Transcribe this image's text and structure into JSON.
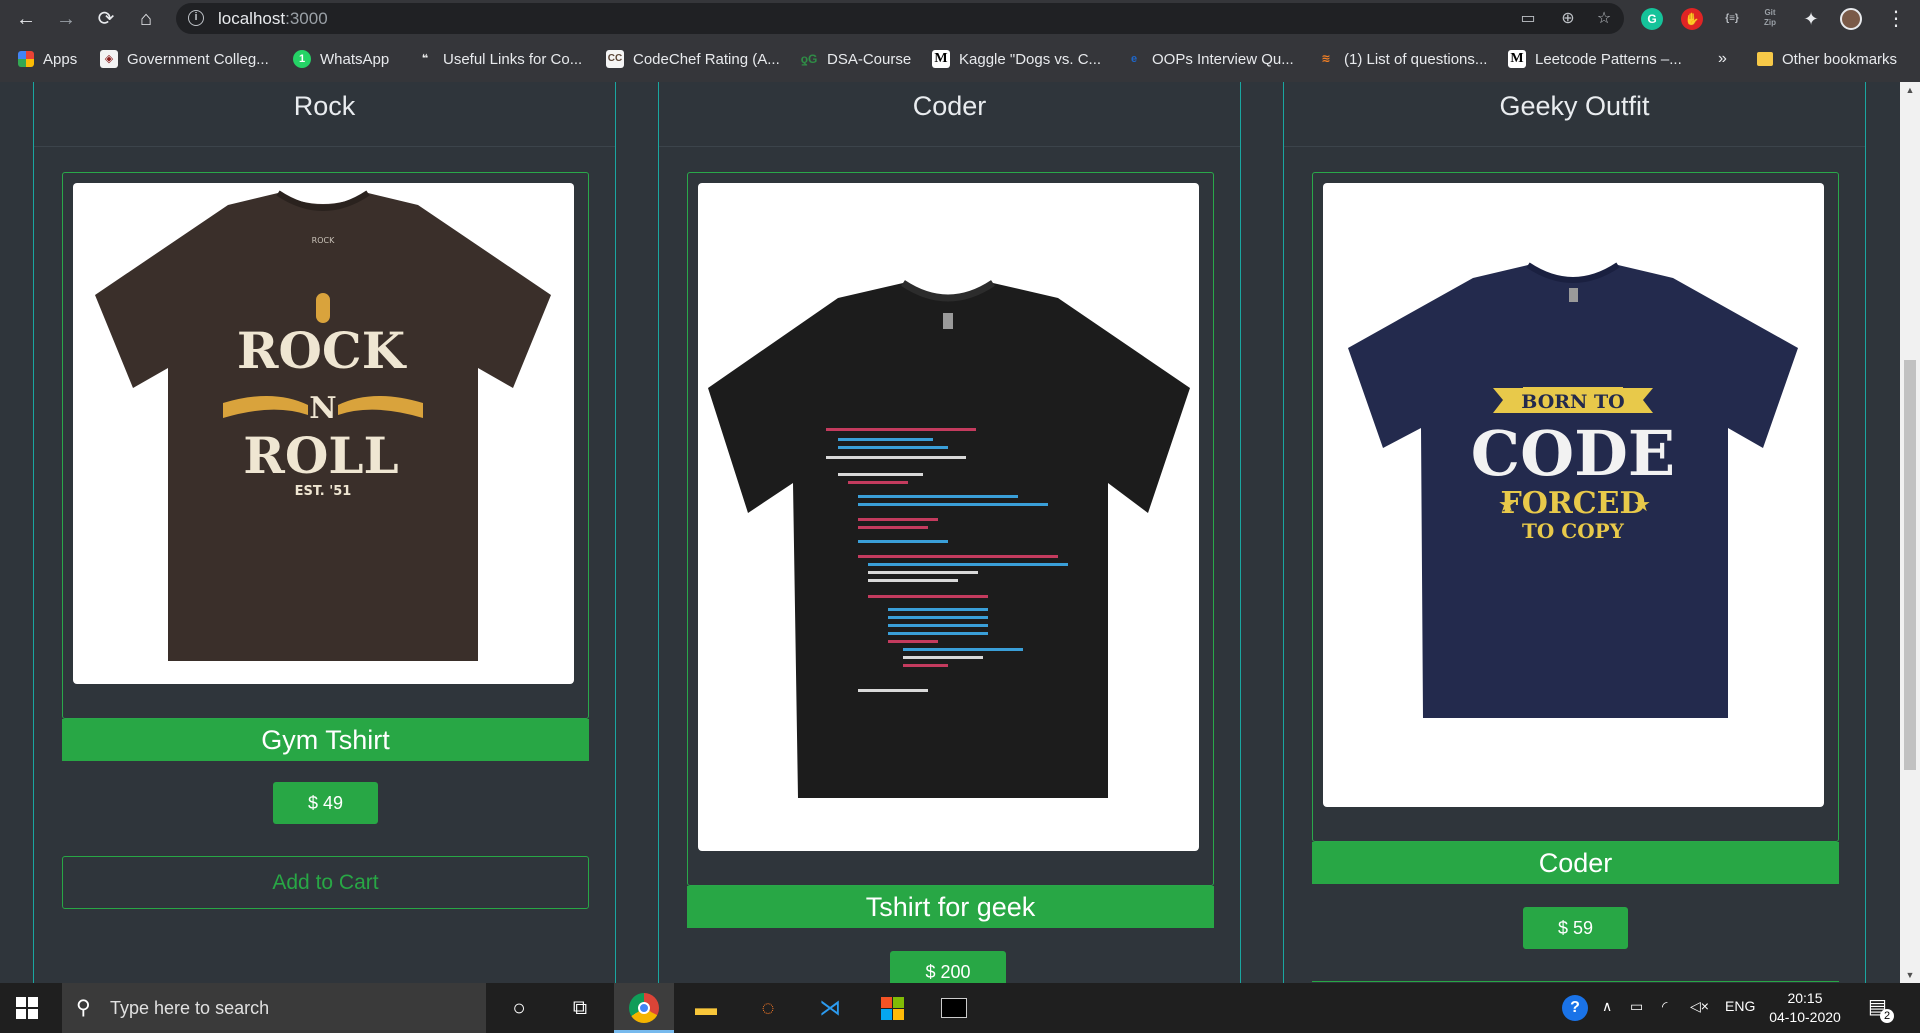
{
  "browser": {
    "url_host": "localhost",
    "url_port": ":3000",
    "bookmarks": [
      {
        "label": "Apps",
        "icon": "apps-grid-icon"
      },
      {
        "label": "Government Colleg...",
        "icon": "college-icon"
      },
      {
        "label": "WhatsApp",
        "icon": "whatsapp-icon"
      },
      {
        "label": "Useful Links for Co...",
        "icon": "chat-bubble-icon"
      },
      {
        "label": "CodeChef Rating (A...",
        "icon": "codechef-icon"
      },
      {
        "label": "DSA-Course",
        "icon": "gfg-icon"
      },
      {
        "label": "Kaggle \"Dogs vs. C...",
        "icon": "medium-icon"
      },
      {
        "label": "OOPs Interview Qu...",
        "icon": "globe-icon"
      },
      {
        "label": "(1) List of questions...",
        "icon": "stack-icon"
      },
      {
        "label": "Leetcode Patterns –...",
        "icon": "medium-icon"
      }
    ],
    "more_bookmarks": "»",
    "other_bookmarks": "Other bookmarks"
  },
  "products": [
    {
      "category": "Rock",
      "name": "Gym Tshirt",
      "price": "$ 49",
      "cart_label": "Add to Cart",
      "shirt_color": "#3a2f2a",
      "print_lines": [
        "ROCK",
        "N",
        "ROLL",
        "EST. '51"
      ]
    },
    {
      "category": "Coder",
      "name": "Tshirt for geek",
      "price": "$ 200",
      "shirt_color": "#1c1c1c"
    },
    {
      "category": "Geeky Outfit",
      "name": "Coder",
      "price": "$ 59",
      "shirt_color": "#232a4d",
      "print_lines": [
        "BORN TO",
        "CODE",
        "FORCED",
        "TO COPY"
      ]
    }
  ],
  "taskbar": {
    "search_placeholder": "Type here to search",
    "language": "ENG",
    "time": "20:15",
    "date": "04-10-2020",
    "notifications": "2"
  },
  "colors": {
    "accent_green": "#28a745",
    "card_border": "#1aa6a0",
    "page_bg": "#2f353b"
  }
}
